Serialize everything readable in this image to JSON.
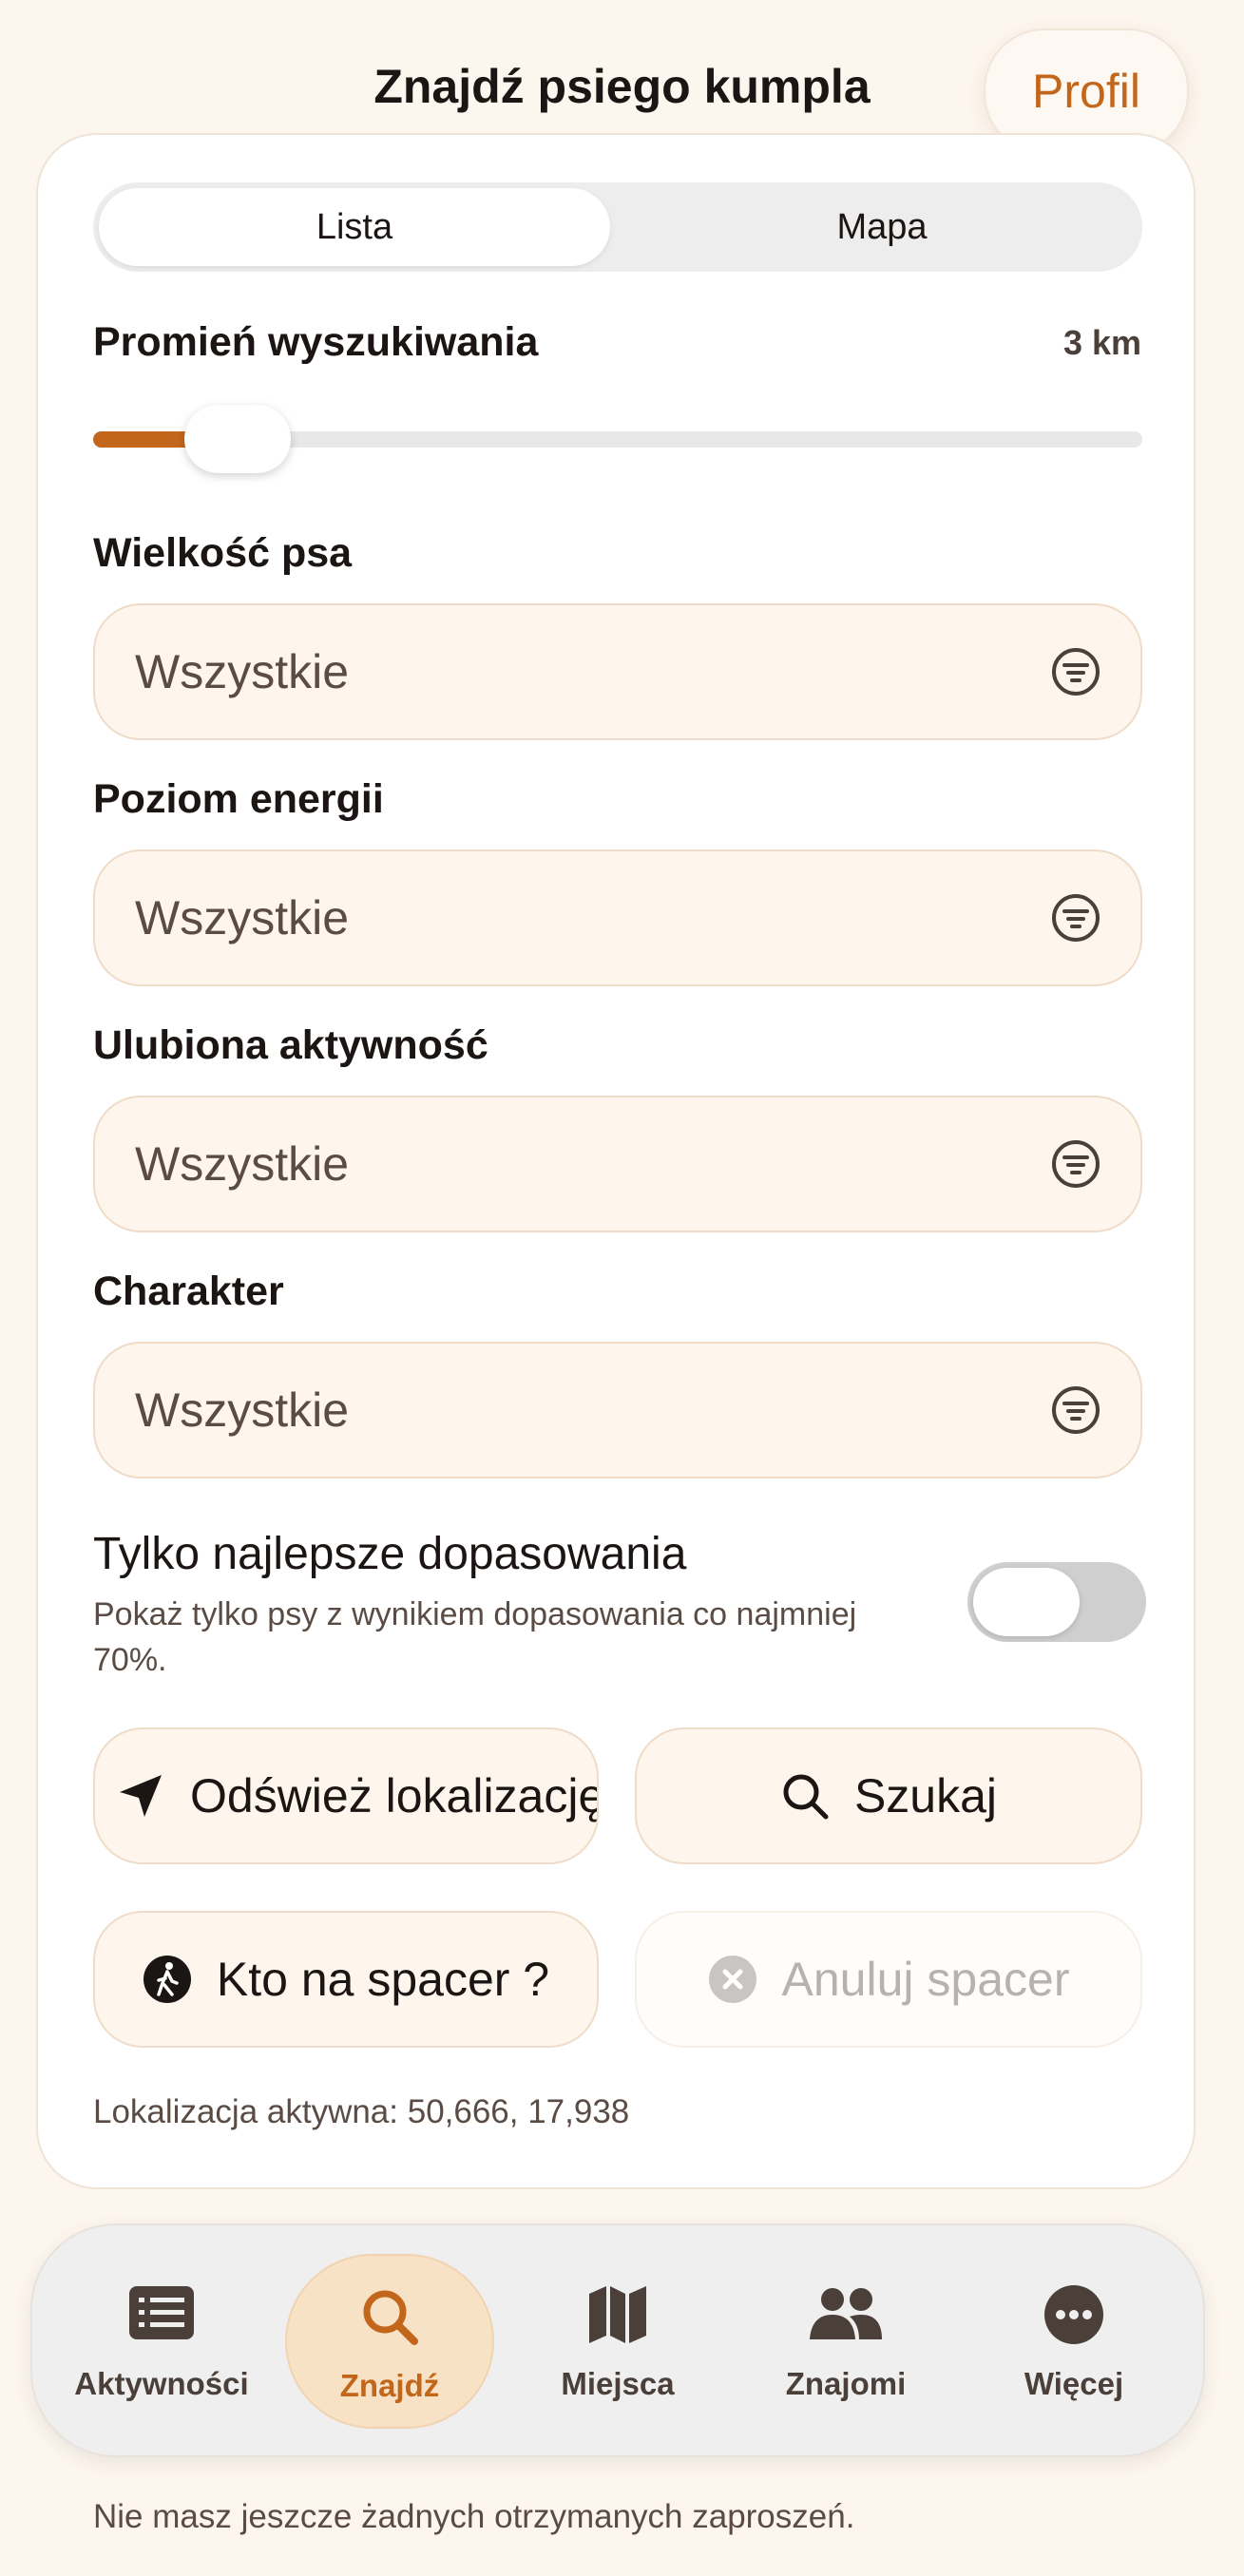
{
  "header": {
    "title": "Znajdź psiego kumpla",
    "profile_label": "Profil"
  },
  "view_toggle": {
    "options": [
      "Lista",
      "Mapa"
    ],
    "selected": "Lista"
  },
  "radius": {
    "label": "Promień wyszukiwania",
    "value_text": "3 km",
    "slider_fraction": 0.05
  },
  "filters": [
    {
      "label": "Wielkość psa",
      "value": "Wszystkie",
      "icon": "filter-icon"
    },
    {
      "label": "Poziom energii",
      "value": "Wszystkie",
      "icon": "filter-icon"
    },
    {
      "label": "Ulubiona aktywność",
      "value": "Wszystkie",
      "icon": "filter-icon"
    },
    {
      "label": "Charakter",
      "value": "Wszystkie",
      "icon": "filter-icon"
    }
  ],
  "best_matches": {
    "title": "Tylko najlepsze dopasowania",
    "description": "Pokaż tylko psy z wynikiem dopasowania co najmniej 70%.",
    "enabled": false
  },
  "actions": {
    "refresh_location": "Odśwież lokalizację",
    "search": "Szukaj",
    "walk_invite": "Kto na spacer ?",
    "cancel_walk": "Anuluj spacer"
  },
  "location_status": "Lokalizacja aktywna: 50,666, 17,938",
  "nav": {
    "items": [
      {
        "label": "Aktywności",
        "icon": "list-icon"
      },
      {
        "label": "Znajdź",
        "icon": "search-icon",
        "active": true
      },
      {
        "label": "Miejsca",
        "icon": "map-icon"
      },
      {
        "label": "Znajomi",
        "icon": "people-icon"
      },
      {
        "label": "Więcej",
        "icon": "more-icon"
      }
    ]
  },
  "invites_note": "Nie masz jeszcze żadnych otrzymanych zaproszeń.",
  "colors": {
    "accent": "#c2661c",
    "field_bg": "#fef6ec",
    "active_tab_bg": "#f8e2c6"
  }
}
